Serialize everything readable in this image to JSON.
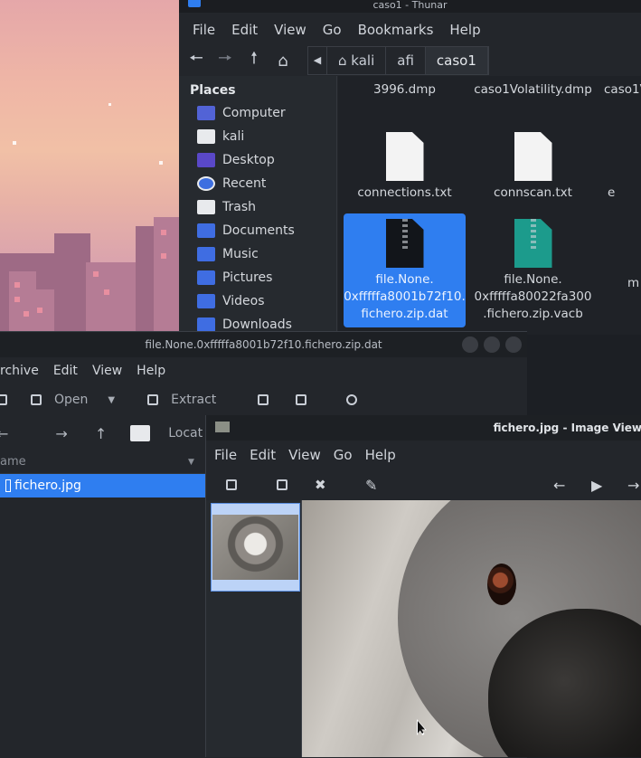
{
  "thunar": {
    "title": "caso1 - Thunar",
    "menu": [
      "File",
      "Edit",
      "View",
      "Go",
      "Bookmarks",
      "Help"
    ],
    "path": [
      "kali",
      "afi",
      "caso1"
    ],
    "places_header": "Places",
    "places": [
      "Computer",
      "kali",
      "Desktop",
      "Recent",
      "Trash",
      "Documents",
      "Music",
      "Pictures",
      "Videos",
      "Downloads"
    ],
    "files_top": [
      "3996.dmp",
      "caso1Volatility.dmp",
      "caso1V"
    ],
    "files": [
      {
        "name": "connections.txt"
      },
      {
        "name": "connscan.txt"
      },
      {
        "name": "e"
      },
      {
        "name_l1": "file.None.",
        "name_l2": "0xfffffa8001b72f10.",
        "name_l3": "fichero.zip.dat"
      },
      {
        "name_l1": "file.None.",
        "name_l2": "0xfffffa80022fa300",
        "name_l3": ".fichero.zip.vacb"
      },
      {
        "name": "m"
      }
    ]
  },
  "archive": {
    "title": "file.None.0xfffffa8001b72f10.fichero.zip.dat",
    "menu": [
      "rchive",
      "Edit",
      "View",
      "Help"
    ],
    "open_label": "Open",
    "extract_label": "Extract",
    "location_label": "Locat",
    "column_name": "ame",
    "row": "fichero.jpg"
  },
  "viewer": {
    "title": "fichero.jpg - Image View",
    "menu": [
      "File",
      "Edit",
      "View",
      "Go",
      "Help"
    ]
  }
}
